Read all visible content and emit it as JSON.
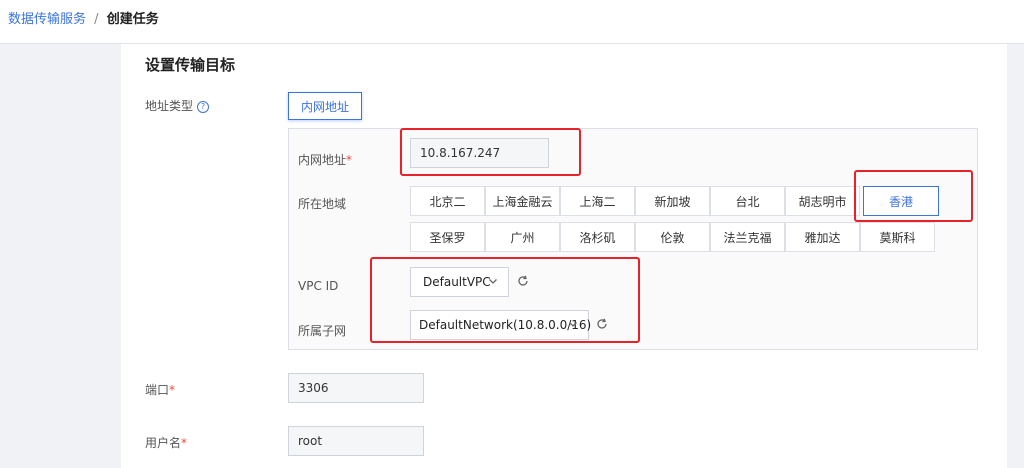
{
  "breadcrumb": {
    "parent": "数据传输服务",
    "separator": "/",
    "current": "创建任务"
  },
  "section_title": "设置传输目标",
  "address_type": {
    "label": "地址类型",
    "help_icon": "question-circle-icon",
    "selected": "内网地址"
  },
  "private_address": {
    "label": "内网地址",
    "required_mark": "*",
    "value": "10.8.167.247"
  },
  "region": {
    "label": "所在地域",
    "row1": [
      "北京二",
      "上海金融云",
      "上海二",
      "新加坡",
      "台北",
      "胡志明市",
      "香港"
    ],
    "row2": [
      "圣保罗",
      "广州",
      "洛杉矶",
      "伦敦",
      "法兰克福",
      "雅加达",
      "莫斯科"
    ],
    "selected": "香港"
  },
  "vpc": {
    "label": "VPC ID",
    "value": "DefaultVPC",
    "caret_icon": "chevron-down-icon",
    "refresh_icon": "refresh-icon"
  },
  "subnet": {
    "label": "所属子网",
    "value": "DefaultNetwork(10.8.0.0/16)",
    "caret_icon": "chevron-down-icon",
    "refresh_icon": "refresh-icon"
  },
  "port": {
    "label": "端口",
    "required_mark": "*",
    "value": "3306"
  },
  "username": {
    "label": "用户名",
    "required_mark": "*",
    "value": "root"
  },
  "colors": {
    "accent": "#3b73e3",
    "annotation": "#e8222a",
    "required": "#e74c3c"
  }
}
